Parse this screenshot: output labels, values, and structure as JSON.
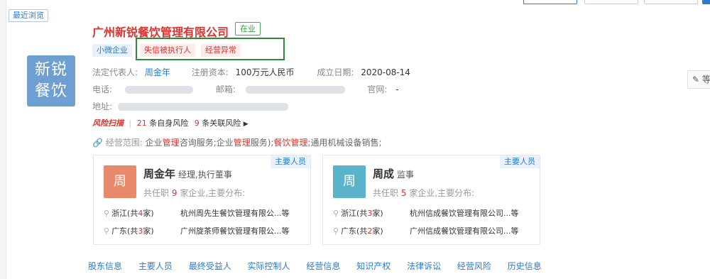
{
  "recent_label": "最近浏览",
  "company": {
    "logo_line1": "新锐",
    "logo_line2": "餐饮",
    "name": "广州新锐餐饮管理有限公司",
    "status": "在业",
    "tags": [
      "小微企业",
      "失信被执行人",
      "经营异常"
    ],
    "legal_rep_label": "法定代表人:",
    "legal_rep": "周金年",
    "capital_label": "注册资本:",
    "capital": "100万元人民币",
    "founded_label": "成立日期:",
    "founded": "2020-08-14",
    "phone_label": "电话:",
    "email_label": "邮箱:",
    "website_label": "官网:",
    "website": "-",
    "address_label": "地址:"
  },
  "risk": {
    "brand": "风险扫描",
    "self_count": "21",
    "self_label": "条自身风险",
    "related_count": "9",
    "related_label": "条关联风险"
  },
  "scope": {
    "label": "经营范围:",
    "parts": [
      "企业",
      "管理",
      "咨询服务;企业",
      "管理",
      "服务);",
      "餐饮管理",
      ";通用机械设备销售;"
    ]
  },
  "edit_label": "等",
  "persons": [
    {
      "role_tag": "主要人员",
      "avatar": "周",
      "avatar_color": "#e8896c",
      "name": "周金年",
      "position": "经理,执行董事",
      "count_pre": "共任职",
      "count": "9",
      "count_post": "家企业,主要分布:",
      "dist": [
        {
          "prov": "浙江(共",
          "n": "4",
          "post": "家)",
          "company": "杭州周先生餐饮管理有限公...等"
        },
        {
          "prov": "广东(共",
          "n": "3",
          "post": "家)",
          "company": "广州旋茶师餐饮管理有限公...等"
        }
      ]
    },
    {
      "role_tag": "主要人员",
      "avatar": "周",
      "avatar_color": "#5ab3c8",
      "name": "周成",
      "position": "监事",
      "count_pre": "共任职",
      "count": "5",
      "count_post": "家企业,主要分布:",
      "dist": [
        {
          "prov": "浙江(共",
          "n": "3",
          "post": "家)",
          "company": "杭州信成餐饮管理有限公司...等"
        },
        {
          "prov": "广东(共",
          "n": "2",
          "post": "家)",
          "company": "广州信成餐饮管理有限公司...等"
        }
      ]
    }
  ],
  "tabs": [
    "股东信息",
    "主要人员",
    "最终受益人",
    "实际控制人",
    "经营信息",
    "知识产权",
    "法律诉讼",
    "经营风险",
    "历史信息"
  ]
}
